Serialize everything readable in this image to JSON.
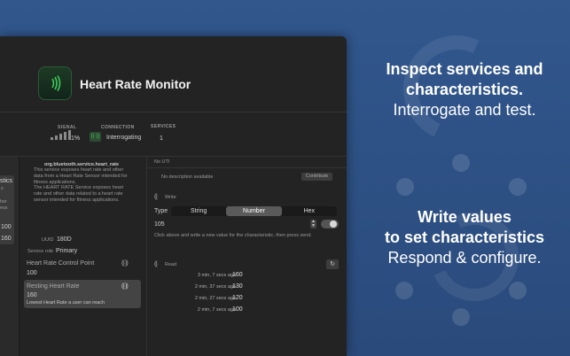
{
  "promo": {
    "heading1_line1": "Inspect services and",
    "heading1_line2": "characteristics.",
    "sub1": "Interrogate and test.",
    "heading2_line1": "Write values",
    "heading2_line2": "to set characteristics",
    "sub2": "Respond & configure."
  },
  "app": {
    "title": "Heart Rate Monitor",
    "signal_label": "SIGNAL",
    "signal_value": "1%",
    "connection_label": "CONNECTION",
    "connection_value": "Interrogating",
    "services_label": "SERVICES",
    "services_value": "1"
  },
  "sidebar": {
    "items": [
      "stics",
      "s",
      "her",
      "ess"
    ],
    "values": [
      "100",
      "160"
    ]
  },
  "service": {
    "name": "org.bluetooth.service.heart_rate",
    "description": "This service exposes heart rate and other data from a Heart Rate Sensor intended for fitness applications.",
    "description2": "The HEART RATE Service exposes heart rate and other data related to a heart rate sensor intended for fitness applications.",
    "uuid_label": "UUID",
    "uuid_value": "180D",
    "role_label": "Service role",
    "role_value": "Primary"
  },
  "characteristics": [
    {
      "name": "Heart Rate Control Point",
      "value": "100"
    },
    {
      "name": "Resting Heart Rate",
      "value": "160",
      "description": "Lowest Heart Rate a user can reach"
    }
  ],
  "detail": {
    "uti": "No UTI",
    "no_description": "No description available",
    "contribute": "Contribute",
    "write_label": "Write",
    "type_label": "Type",
    "type_options": [
      "String",
      "Number",
      "Hex"
    ],
    "selected_type": "Number",
    "write_value": "105",
    "write_hint": "Click above and write a new value for the characteristic, then press send.",
    "read_label": "Read",
    "reads": [
      {
        "time": "3 min, 7 secs ago",
        "value": "160"
      },
      {
        "time": "2 min, 37 secs ago",
        "value": "130"
      },
      {
        "time": "2 min, 27 secs ago",
        "value": "120"
      },
      {
        "time": "2 min, 7 secs ago",
        "value": "100"
      }
    ]
  },
  "colors": {
    "background": "#2c4e80",
    "window": "#232323",
    "accent_green": "#3fc95a"
  }
}
